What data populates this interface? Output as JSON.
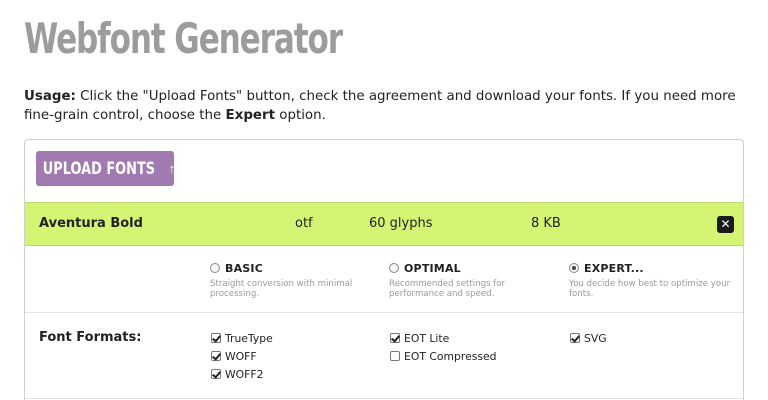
{
  "title": "Webfont Generator",
  "usage": {
    "prefix": "Usage:",
    "text1": " Click the \"Upload Fonts\" button, check the agreement and download your fonts. If you need more fine-grain control, choose the ",
    "bold": "Expert",
    "text2": " option."
  },
  "upload_button": {
    "label": "UPLOAD FONTS",
    "icon": "↑"
  },
  "font_row": {
    "name": "Aventura Bold",
    "format": "otf",
    "glyphs": "60 glyphs",
    "size": "8 KB",
    "close_icon": "✕"
  },
  "modes": [
    {
      "label": "BASIC",
      "desc": "Straight conversion with minimal processing.",
      "selected": false
    },
    {
      "label": "OPTIMAL",
      "desc": "Recommended settings for performance and speed.",
      "selected": false
    },
    {
      "label": "EXPERT...",
      "desc": "You decide how best to optimize your fonts.",
      "selected": true
    }
  ],
  "font_formats": {
    "label": "Font Formats:",
    "options": [
      {
        "label": "TrueType",
        "checked": true
      },
      {
        "label": "WOFF",
        "checked": true
      },
      {
        "label": "WOFF2",
        "checked": true
      },
      {
        "label": "EOT Lite",
        "checked": true
      },
      {
        "label": "EOT Compressed",
        "checked": false
      },
      {
        "label": "SVG",
        "checked": true
      }
    ]
  },
  "colors": {
    "title": "#9c9c9c",
    "button": "#a07ab0",
    "font_row": "#d3f573"
  }
}
